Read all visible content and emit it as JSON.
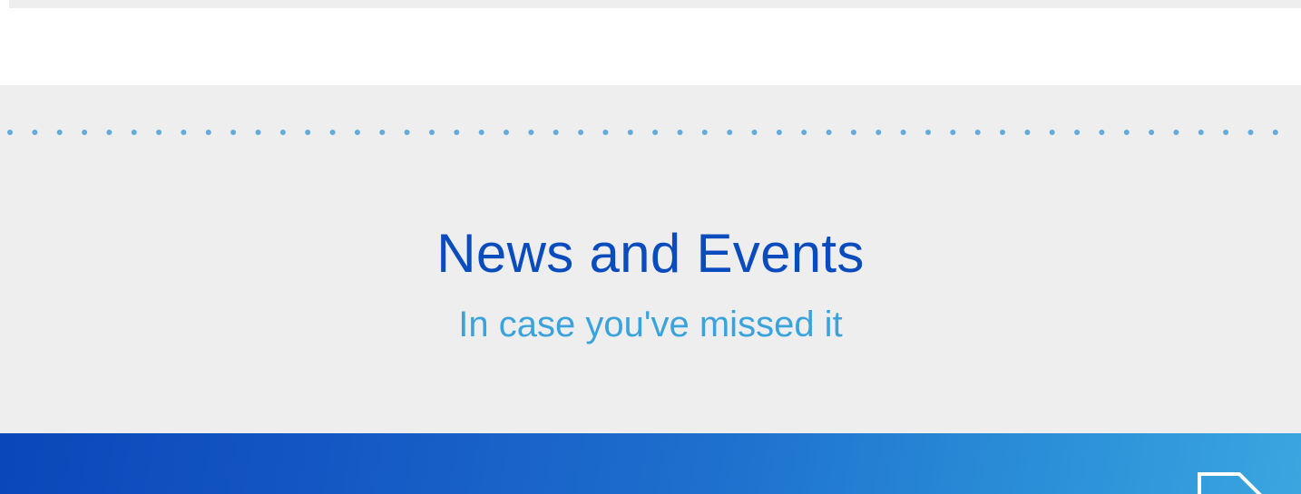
{
  "news_section": {
    "title": "News and Events",
    "subtitle": "In case you've missed it"
  },
  "colors": {
    "section_background": "#eeeeef",
    "title": "#0a4bbd",
    "subtitle": "#3aa3dc",
    "dot": "#4a9fd6",
    "banner_start": "#0a47b8",
    "banner_end": "#3aa6e0"
  },
  "icons": {
    "banner_icon": "document-icon"
  }
}
